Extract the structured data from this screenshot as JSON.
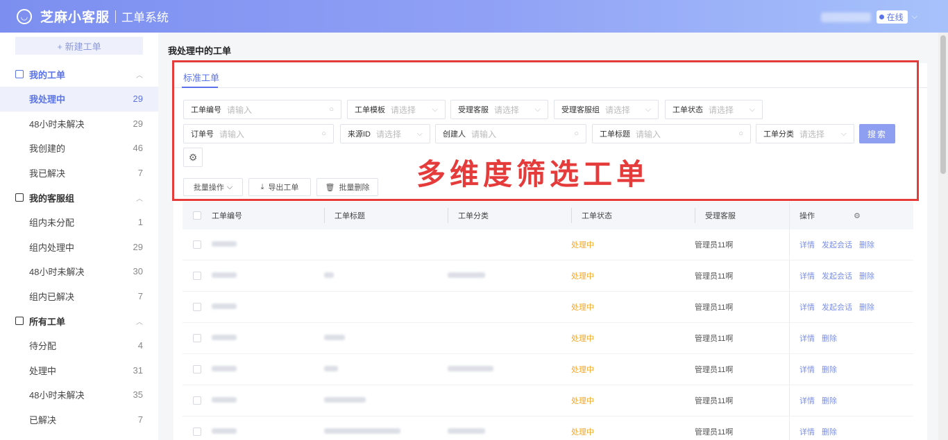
{
  "header": {
    "brand": "芝麻小客服",
    "system": "工单系统",
    "status": "在线"
  },
  "sidebar": {
    "new_button": "+ 新建工单",
    "groups": [
      {
        "title": "我的工单",
        "items": [
          {
            "label": "我处理中",
            "count": "29"
          },
          {
            "label": "48小时未解决",
            "count": "29"
          },
          {
            "label": "我创建的",
            "count": "46"
          },
          {
            "label": "我已解决",
            "count": "7"
          }
        ]
      },
      {
        "title": "我的客服组",
        "items": [
          {
            "label": "组内未分配",
            "count": "1"
          },
          {
            "label": "组内处理中",
            "count": "29"
          },
          {
            "label": "48小时未解决",
            "count": "30"
          },
          {
            "label": "组内已解决",
            "count": "7"
          }
        ]
      },
      {
        "title": "所有工单",
        "items": [
          {
            "label": "待分配",
            "count": "4"
          },
          {
            "label": "处理中",
            "count": "31"
          },
          {
            "label": "48小时未解决",
            "count": "35"
          },
          {
            "label": "已解决",
            "count": "7"
          }
        ]
      }
    ]
  },
  "main": {
    "page_title": "我处理中的工单",
    "tab": "标准工单",
    "filters": {
      "ticket_no": {
        "label": "工单编号",
        "placeholder": "请输入"
      },
      "template": {
        "label": "工单模板",
        "placeholder": "请选择"
      },
      "agent": {
        "label": "受理客服",
        "placeholder": "请选择"
      },
      "agent_group": {
        "label": "受理客服组",
        "placeholder": "请选择"
      },
      "status": {
        "label": "工单状态",
        "placeholder": "请选择"
      },
      "order_no": {
        "label": "订单号",
        "placeholder": "请输入"
      },
      "source_id": {
        "label": "来源ID",
        "placeholder": "请选择"
      },
      "creator": {
        "label": "创建人",
        "placeholder": "请输入"
      },
      "title": {
        "label": "工单标题",
        "placeholder": "请输入"
      },
      "category": {
        "label": "工单分类",
        "placeholder": "请选择"
      }
    },
    "search_button": "搜索",
    "actions": {
      "batch": "批量操作",
      "export": "导出工单",
      "batch_delete": "批量删除"
    },
    "overlay_text": "多维度筛选工单",
    "table": {
      "columns": [
        "工单编号",
        "工单标题",
        "工单分类",
        "工单状态",
        "受理客服",
        "操作"
      ],
      "rows": [
        {
          "status": "处理中",
          "agent": "管理员11啊",
          "ops": [
            "详情",
            "发起会话",
            "删除"
          ]
        },
        {
          "status": "处理中",
          "agent": "管理员11啊",
          "ops": [
            "详情",
            "发起会话",
            "删除"
          ]
        },
        {
          "status": "处理中",
          "agent": "管理员11啊",
          "ops": [
            "详情",
            "发起会话",
            "删除"
          ]
        },
        {
          "status": "处理中",
          "agent": "管理员11啊",
          "ops": [
            "详情",
            "删除"
          ]
        },
        {
          "status": "处理中",
          "agent": "管理员11啊",
          "ops": [
            "详情",
            "删除"
          ]
        },
        {
          "status": "处理中",
          "agent": "管理员11啊",
          "ops": [
            "详情",
            "删除"
          ]
        },
        {
          "status": "处理中",
          "agent": "管理员11啊",
          "ops": [
            "详情",
            "删除"
          ]
        }
      ]
    }
  }
}
